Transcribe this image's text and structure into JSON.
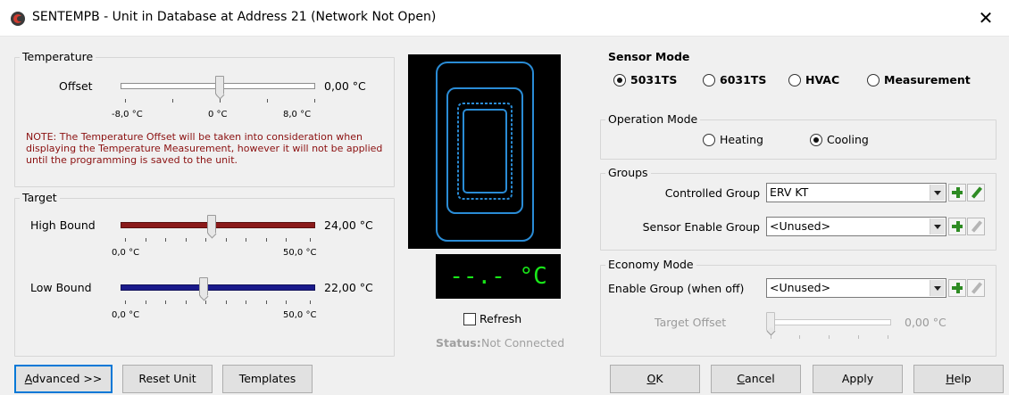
{
  "window": {
    "title": "SENTEMPB - Unit in Database at Address 21 (Network Not Open)",
    "close_glyph": "✕"
  },
  "temperature": {
    "group_label": "Temperature",
    "offset_label": "Offset",
    "offset_value": "0,00 °C",
    "offset_position_fraction": 0.5,
    "scale": [
      "-8,0 °C",
      "0 °C",
      "8,0 °C"
    ],
    "note": "NOTE: The Temperature Offset will be taken into consideration when displaying the Temperature Measurement, however it will not be applied until the programming is saved to the unit."
  },
  "target": {
    "group_label": "Target",
    "high_label": "High Bound",
    "high_value": "24,00 °C",
    "high_position_fraction": 0.48,
    "low_label": "Low Bound",
    "low_value": "22,00 °C",
    "low_position_fraction": 0.44,
    "scale": [
      "0,0 °C",
      "50,0 °C"
    ],
    "high_color": "#8b1a1a",
    "low_color": "#1a1a8b"
  },
  "preview": {
    "display_text": "--.- °C",
    "display_color": "#19e619",
    "outline_color": "#2a8cd6",
    "refresh_label": "Refresh",
    "refresh_checked": false,
    "status_label": "Status:",
    "status_value": "Not Connected"
  },
  "sensor_mode": {
    "label": "Sensor Mode",
    "options": [
      "5031TS",
      "6031TS",
      "HVAC",
      "Measurement"
    ],
    "selected": "5031TS"
  },
  "operation_mode": {
    "label": "Operation Mode",
    "options": [
      "Heating",
      "Cooling"
    ],
    "selected": "Cooling"
  },
  "groups": {
    "label": "Groups",
    "controlled_label": "Controlled Group",
    "controlled_value": "ERV KT",
    "sensor_enable_label": "Sensor Enable Group",
    "sensor_enable_value": "<Unused>"
  },
  "economy": {
    "label": "Economy Mode",
    "enable_label": "Enable Group (when off)",
    "enable_value": "<Unused>",
    "target_offset_label": "Target Offset",
    "target_offset_value": "0,00 °C",
    "target_offset_fraction": 0.0
  },
  "buttons": {
    "advanced": "dvanced >>",
    "advanced_mnemonic": "A",
    "reset": "Reset Unit",
    "templates": "Templates",
    "ok": "K",
    "ok_mnemonic": "O",
    "cancel": "ancel",
    "cancel_mnemonic": "C",
    "apply": "Apply",
    "help": "elp",
    "help_mnemonic": "H"
  }
}
